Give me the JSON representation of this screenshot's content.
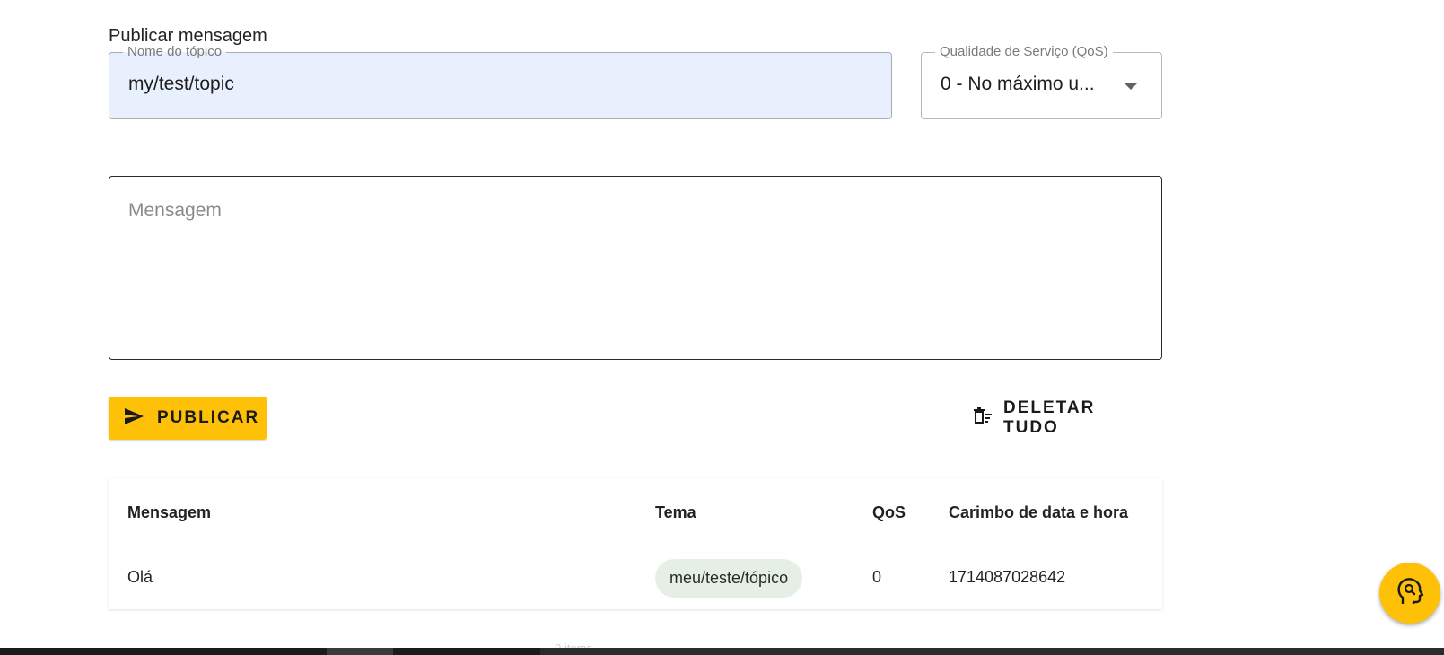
{
  "section": {
    "title": "Publicar mensagem"
  },
  "topic_field": {
    "label": "Nome do tópico",
    "value": "my/test/topic"
  },
  "qos_field": {
    "label": "Qualidade de Serviço (QoS)",
    "value": "0 - No máximo u..."
  },
  "message_field": {
    "placeholder": "Mensagem"
  },
  "actions": {
    "publish_label": "PUBLICAR",
    "delete_all_label": "DELETAR TUDO"
  },
  "table": {
    "headers": {
      "message": "Mensagem",
      "topic": "Tema",
      "qos": "QoS",
      "timestamp": "Carimbo de data e hora"
    },
    "rows": [
      {
        "message": "Olá",
        "topic": "meu/teste/tópico",
        "qos": "0",
        "timestamp": "1714087028642"
      }
    ]
  },
  "fab": {
    "icon": "head-search-icon"
  },
  "taskbar": {
    "text": "0 items"
  },
  "colors": {
    "accent": "#ffc107",
    "topic_bg": "#e8f0fe",
    "chip_bg": "#e6efe6"
  }
}
